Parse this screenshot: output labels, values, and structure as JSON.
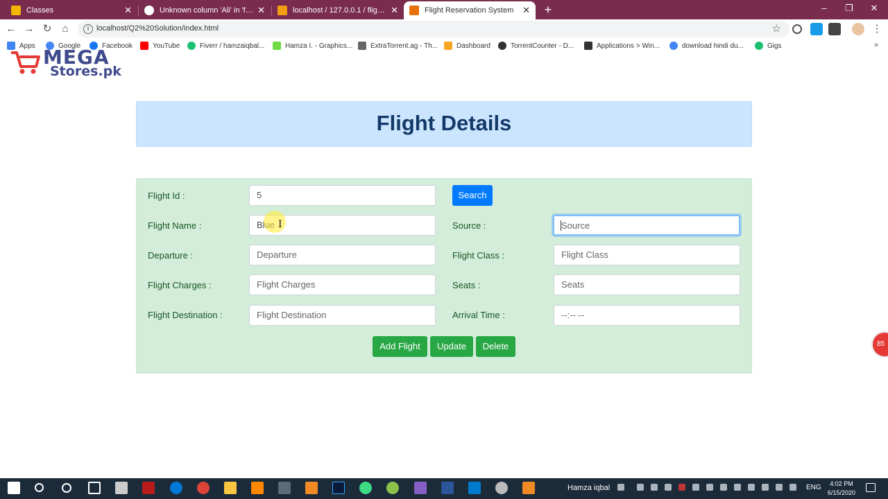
{
  "browser": {
    "tabs": [
      {
        "label": "Classes",
        "favicon_color": "#f4b400",
        "active": false
      },
      {
        "label": "Unknown column 'Ali' in 'field list'",
        "favicon_color": "#ffffff",
        "active": false
      },
      {
        "label": "localhost / 127.0.0.1 / flight_reservation",
        "favicon_color": "#f39c12",
        "active": false
      },
      {
        "label": "Flight Reservation System",
        "favicon_color": "#e8710a",
        "active": true
      }
    ],
    "new_tab": "+",
    "window_controls": {
      "minimize": "–",
      "restore": "❐",
      "close": "✕"
    },
    "url": "localhost/Q2%20Solution/index.html",
    "bookmarks": [
      {
        "label": "Apps",
        "icon_color": "#4285f4"
      },
      {
        "label": "Google",
        "icon_color": "#4285f4"
      },
      {
        "label": "Facebook",
        "icon_color": "#1877f2"
      },
      {
        "label": "YouTube",
        "icon_color": "#ff0000"
      },
      {
        "label": "Fiverr / hamzaiqbal...",
        "icon_color": "#1dbf73"
      },
      {
        "label": "Hamza I. - Graphics...",
        "icon_color": "#6fda44"
      },
      {
        "label": "ExtraTorrent.ag - Th...",
        "icon_color": "#666666"
      },
      {
        "label": "Dashboard",
        "icon_color": "#f5a623"
      },
      {
        "label": "TorrentCounter - D...",
        "icon_color": "#333333"
      },
      {
        "label": "Applications > Win...",
        "icon_color": "#333333"
      },
      {
        "label": "download hindi du...",
        "icon_color": "#4285f4"
      },
      {
        "label": "Gigs",
        "icon_color": "#1dbf73"
      }
    ],
    "bookmarks_more": "»"
  },
  "watermark": {
    "line1": "MEGA",
    "line2": "Stores.pk",
    "color": "#3e4a8c"
  },
  "page": {
    "title": "Flight Details",
    "title_color": "#123a69",
    "form": {
      "flight_id": {
        "label": "Flight Id :",
        "value": "5"
      },
      "search_button": "Search",
      "flight_name": {
        "label": "Flight Name :",
        "value": "Blue"
      },
      "source": {
        "label": "Source :",
        "placeholder": "Source"
      },
      "departure": {
        "label": "Departure :",
        "placeholder": "Departure"
      },
      "flight_class": {
        "label": "Flight Class :",
        "placeholder": "Flight Class"
      },
      "flight_charges": {
        "label": "Flight Charges :",
        "placeholder": "Flight Charges"
      },
      "seats": {
        "label": "Seats :",
        "placeholder": "Seats"
      },
      "flight_destination": {
        "label": "Flight Destination :",
        "placeholder": "Flight Destination"
      },
      "arrival_time": {
        "label": "Arrival Time :",
        "placeholder": "--:-- --"
      },
      "buttons": {
        "add": "Add Flight",
        "update": "Update",
        "delete": "Delete"
      }
    },
    "notification_badge": "85"
  },
  "taskbar": {
    "user": "Hamza iqbal",
    "lang": "ENG",
    "time": "4:02 PM",
    "date": "6/15/2020"
  }
}
